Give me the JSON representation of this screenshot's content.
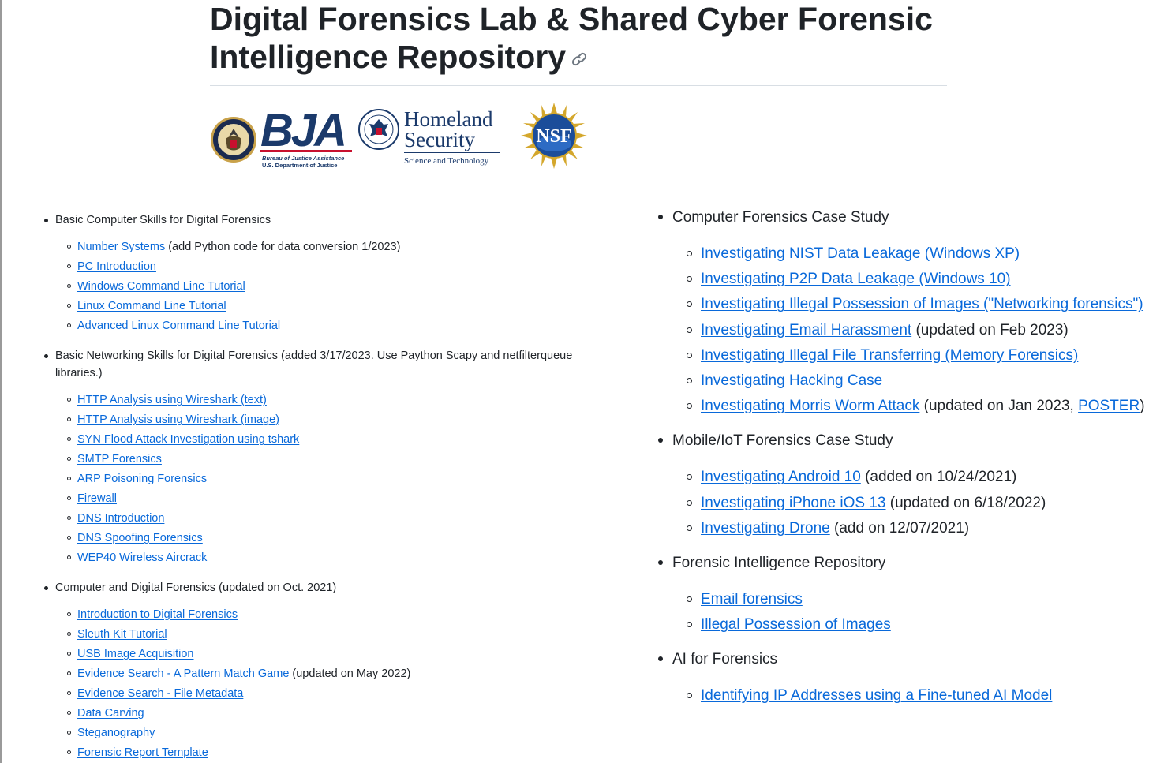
{
  "page": {
    "title": "Digital Forensics Lab & Shared Cyber Forensic Intelligence Repository"
  },
  "logos": {
    "bja_text": "BJA",
    "bja_sub1": "Bureau of Justice Assistance",
    "bja_sub2": "U.S. Department of Justice",
    "dhs_line1": "Homeland",
    "dhs_line2": "Security",
    "dhs_sub": "Science and Technology",
    "nsf_text": "NSF"
  },
  "left_sections": [
    {
      "label": "Basic Computer Skills for Digital Forensics",
      "items": [
        {
          "link": "Number Systems",
          "note": " (add Python code for data conversion 1/2023)"
        },
        {
          "link": "PC Introduction",
          "note": ""
        },
        {
          "link": "Windows Command Line Tutorial",
          "note": ""
        },
        {
          "link": "Linux Command Line Tutorial",
          "note": ""
        },
        {
          "link": "Advanced Linux Command Line Tutorial",
          "note": ""
        }
      ]
    },
    {
      "label": "Basic Networking Skills for Digital Forensics (added 3/17/2023. Use Paython Scapy and netfilterqueue libraries.)",
      "items": [
        {
          "link": "HTTP Analysis using Wireshark (text)",
          "note": ""
        },
        {
          "link": "HTTP Analysis using Wireshark (image)",
          "note": ""
        },
        {
          "link": "SYN Flood Attack Investigation using tshark",
          "note": ""
        },
        {
          "link": "SMTP Forensics",
          "note": ""
        },
        {
          "link": "ARP Poisoning Forensics",
          "note": ""
        },
        {
          "link": "Firewall",
          "note": ""
        },
        {
          "link": "DNS Introduction",
          "note": ""
        },
        {
          "link": "DNS Spoofing Forensics",
          "note": ""
        },
        {
          "link": "WEP40 Wireless Aircrack",
          "note": ""
        }
      ]
    },
    {
      "label": "Computer and Digital Forensics (updated on Oct. 2021)",
      "items": [
        {
          "link": "Introduction to Digital Forensics",
          "note": ""
        },
        {
          "link": "Sleuth Kit Tutorial",
          "note": ""
        },
        {
          "link": "USB Image Acquisition",
          "note": ""
        },
        {
          "link": "Evidence Search - A Pattern Match Game",
          "note": " (updated on May 2022)"
        },
        {
          "link": "Evidence Search - File Metadata",
          "note": ""
        },
        {
          "link": "Data Carving",
          "note": ""
        },
        {
          "link": "Steganography",
          "note": ""
        },
        {
          "link": "Forensic Report Template",
          "note": ""
        }
      ]
    }
  ],
  "right_sections": [
    {
      "label": "Computer Forensics Case Study",
      "items": [
        {
          "link": "Investigating NIST Data Leakage (Windows XP)",
          "note": ""
        },
        {
          "link": "Investigating P2P Data Leakage (Windows 10)",
          "note": ""
        },
        {
          "link": "Investigating Illegal Possession of Images (\"Networking forensics\")",
          "note": ""
        },
        {
          "link": "Investigating Email Harassment",
          "note": " (updated on Feb 2023)"
        },
        {
          "link": "Investigating Illegal File Transferring (Memory Forensics)",
          "note": ""
        },
        {
          "link": "Investigating Hacking Case",
          "note": ""
        },
        {
          "link": "Investigating Morris Worm Attack",
          "note": " (updated on Jan 2023, ",
          "link2": "POSTER",
          "note2": ")"
        }
      ]
    },
    {
      "label": "Mobile/IoT Forensics Case Study",
      "items": [
        {
          "link": "Investigating Android 10",
          "note": " (added on 10/24/2021)"
        },
        {
          "link": "Investigating iPhone iOS 13",
          "note": " (updated on 6/18/2022)"
        },
        {
          "link": "Investigating Drone",
          "note": " (add on 12/07/2021)"
        }
      ]
    },
    {
      "label": "Forensic Intelligence Repository",
      "items": [
        {
          "link": "Email forensics",
          "note": ""
        },
        {
          "link": "Illegal Possession of Images",
          "note": ""
        }
      ]
    },
    {
      "label": "AI for Forensics",
      "items": [
        {
          "link": "Identifying IP Addresses using a Fine-tuned AI Model",
          "note": ""
        }
      ]
    }
  ]
}
